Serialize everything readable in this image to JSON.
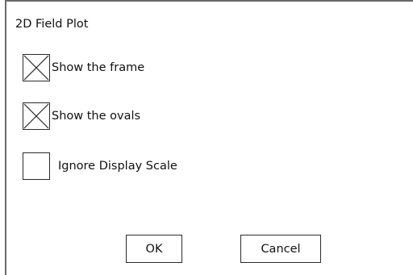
{
  "dialog": {
    "title": "2D Field Plot"
  },
  "options": [
    {
      "label": "Show the frame",
      "checked": true
    },
    {
      "label": "Show the ovals",
      "checked": true
    },
    {
      "label": "Ignore Display Scale",
      "checked": false
    }
  ],
  "buttons": {
    "ok_label": "OK",
    "cancel_label": "Cancel"
  }
}
